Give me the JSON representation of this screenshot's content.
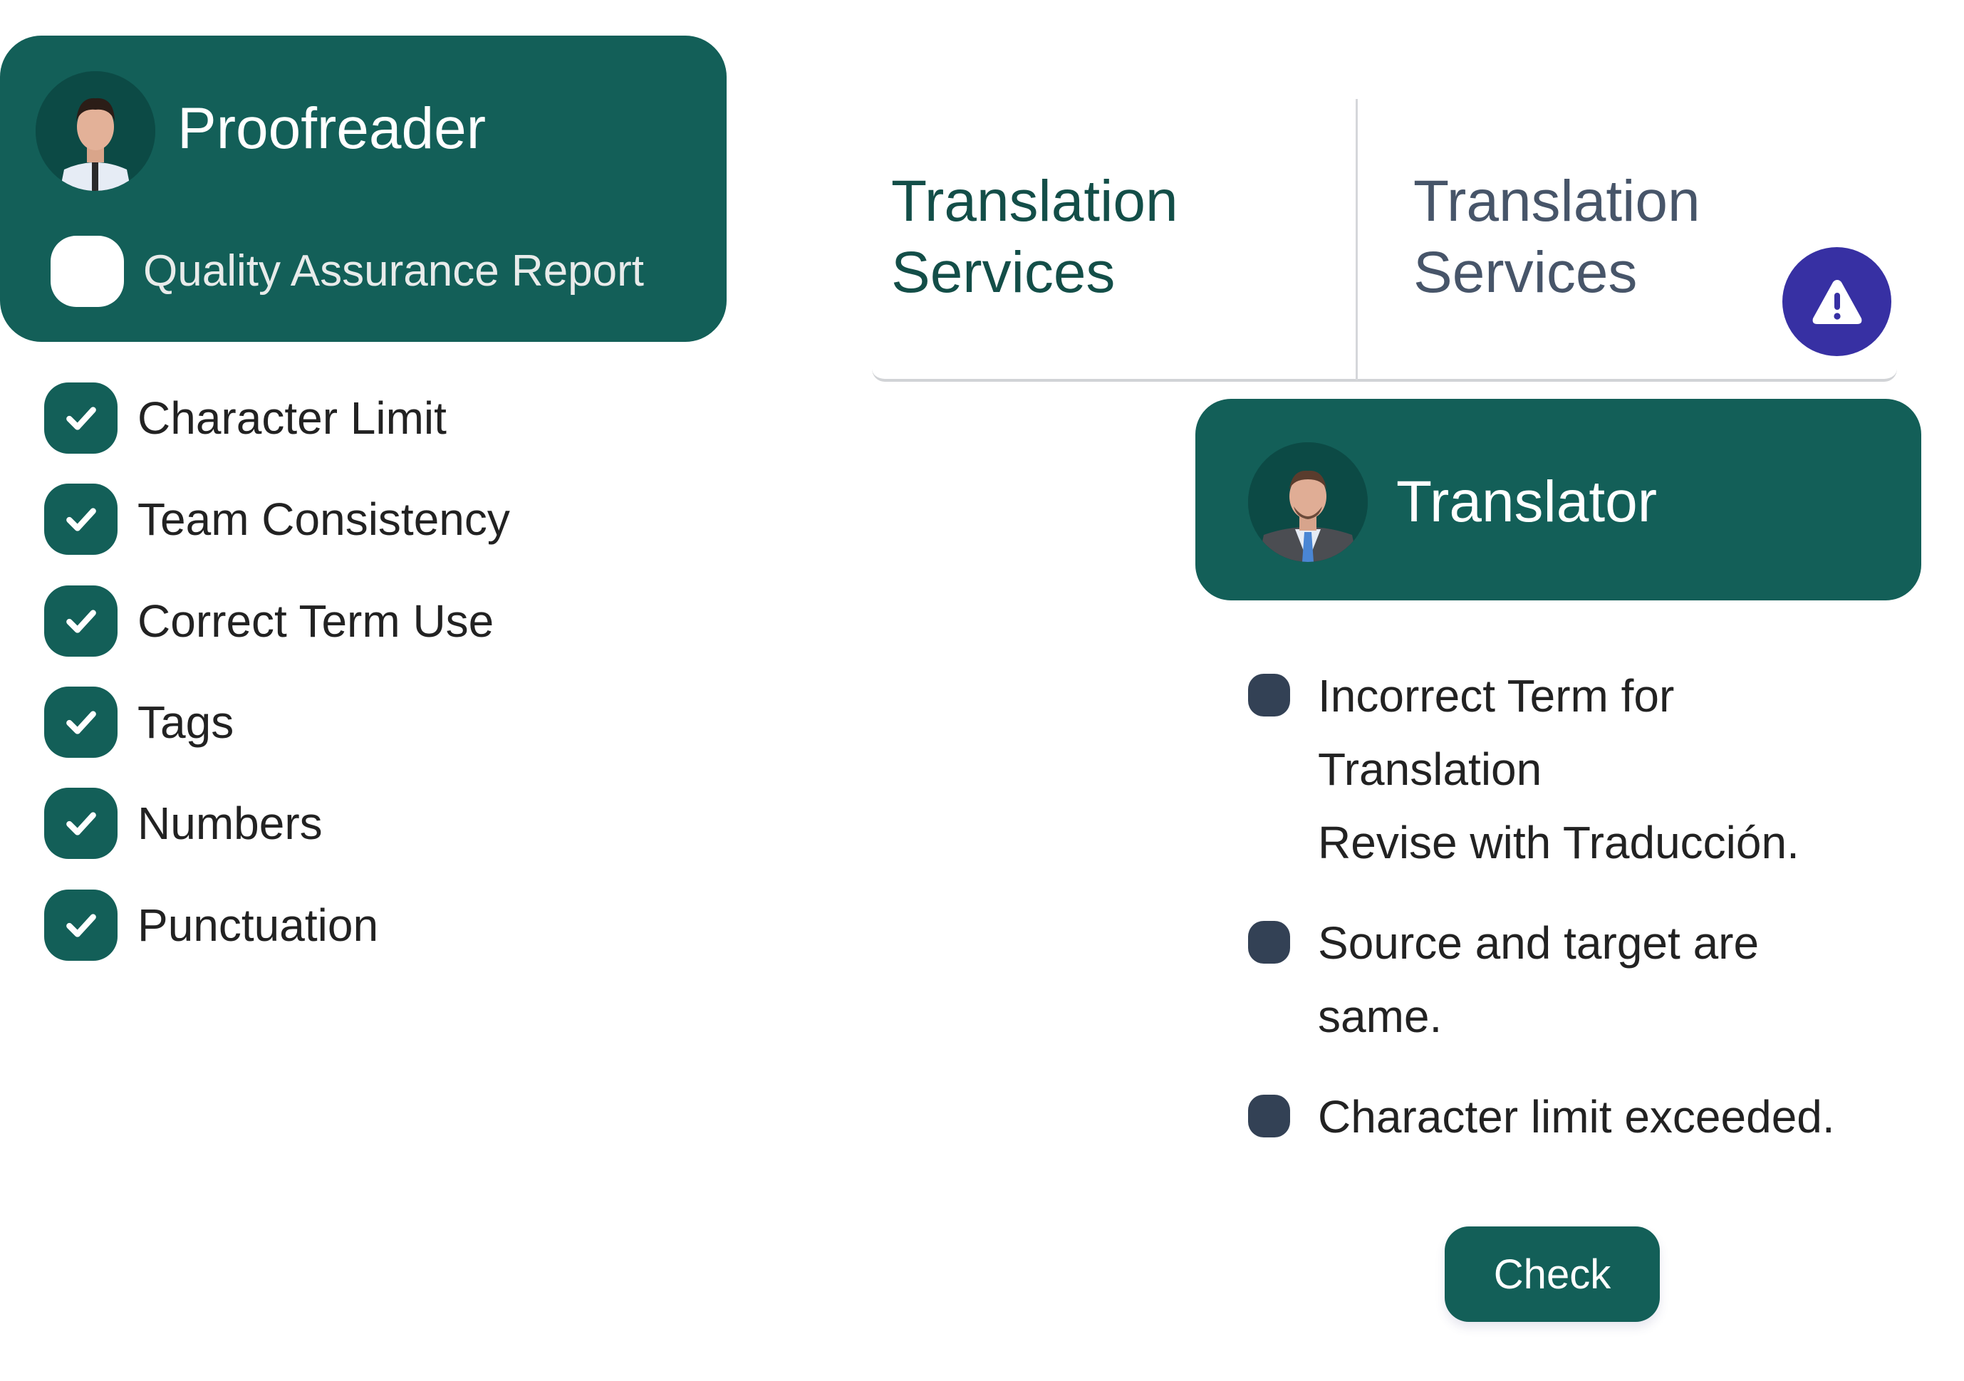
{
  "proofreader": {
    "title": "Proofreader",
    "avatar_icon": "person-photo-icon",
    "qa_report_label": "Quality Assurance Report",
    "qa_report_checked": false
  },
  "checklist": [
    {
      "label": "Character Limit",
      "checked": true
    },
    {
      "label": "Team Consistency",
      "checked": true
    },
    {
      "label": "Correct Term Use",
      "checked": true
    },
    {
      "label": "Tags",
      "checked": true
    },
    {
      "label": "Numbers",
      "checked": true
    },
    {
      "label": "Punctuation",
      "checked": true
    }
  ],
  "tabs": [
    {
      "label": "Translation\nServices",
      "active": true
    },
    {
      "label": "Translation\nServices",
      "active": false
    }
  ],
  "alert": {
    "icon": "warning-triangle-icon"
  },
  "translator": {
    "title": "Translator",
    "avatar_icon": "person-photo-icon"
  },
  "issues": [
    {
      "text": "Incorrect Term for\nTranslation\nRevise with Traducción."
    },
    {
      "text": "Source and target are\nsame."
    },
    {
      "text": "Character limit exceeded."
    }
  ],
  "check_button": {
    "label": "Check"
  },
  "colors": {
    "primary": "#135f58",
    "alert": "#3730a3",
    "bullet": "#334155",
    "tab_active_text": "#134e48",
    "tab_inactive_text": "#475569"
  }
}
